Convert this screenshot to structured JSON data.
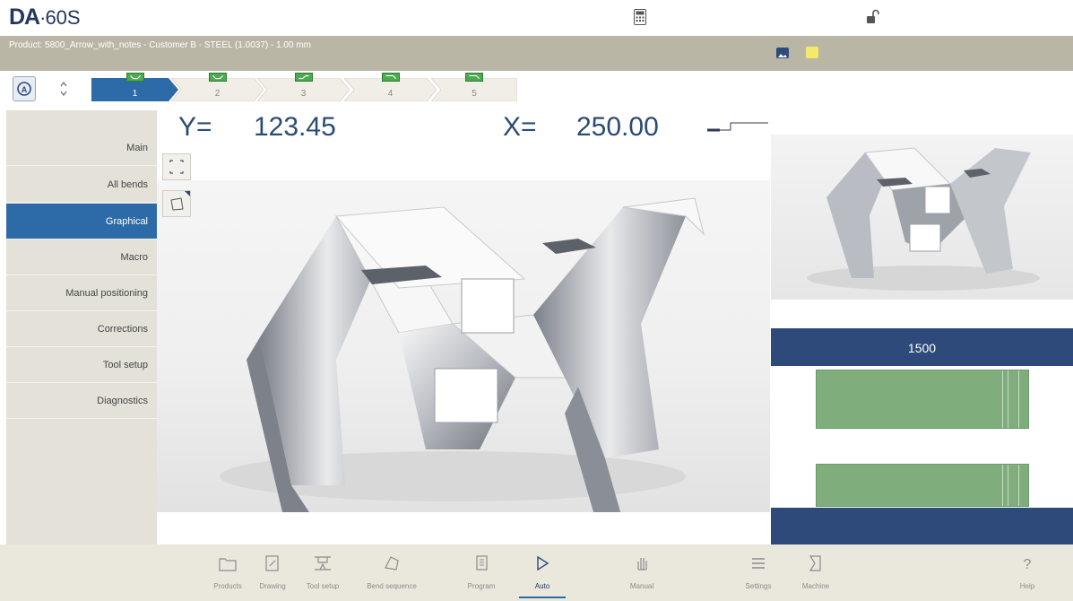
{
  "brand": {
    "logo_main": "DA",
    "logo_dot": "·",
    "logo_model": "60S"
  },
  "topbar": {
    "calculator_icon": "calculator-icon",
    "lock_icon": "unlocked-padlock-icon"
  },
  "product": {
    "text": "Product: 5800_Arrow_with_notes - Customer B - STEEL (1.0037) - 1.00 mm"
  },
  "bends": {
    "active": 0,
    "tabs": [
      {
        "num": "1"
      },
      {
        "num": "2"
      },
      {
        "num": "3"
      },
      {
        "num": "4"
      },
      {
        "num": "5"
      }
    ]
  },
  "menu": {
    "items": [
      {
        "label": "Main"
      },
      {
        "label": "All bends"
      },
      {
        "label": "Graphical",
        "active": true
      },
      {
        "label": "Macro"
      },
      {
        "label": "Manual positioning"
      },
      {
        "label": "Corrections"
      },
      {
        "label": "Tool setup"
      },
      {
        "label": "Diagnostics"
      }
    ]
  },
  "positions": {
    "y_label": "Y=",
    "y_value": "123.45",
    "x_label": "X=",
    "x_value": "250.00"
  },
  "machine_view": {
    "length": "1500"
  },
  "colors": {
    "accent": "#2d6aa8",
    "navy": "#2d4a7a",
    "product_bar": "#bab6a6",
    "menu_bg": "#e3e1d8",
    "tool_green": "#7fae7c",
    "bend_green": "#4daa50"
  },
  "nav": {
    "items": [
      {
        "label": "Products",
        "icon": "folder-icon"
      },
      {
        "label": "Drawing",
        "icon": "pencil-icon"
      },
      {
        "label": "Tool setup",
        "icon": "tool-setup-icon"
      },
      {
        "label": "Bend sequence",
        "icon": "bend-sequence-icon"
      },
      {
        "label": "Program",
        "icon": "program-icon"
      },
      {
        "label": "Auto",
        "icon": "play-icon",
        "active": true
      },
      {
        "label": "Manual",
        "icon": "hand-icon"
      },
      {
        "label": "Settings",
        "icon": "list-icon"
      },
      {
        "label": "Machine",
        "icon": "machine-icon"
      },
      {
        "label": "Help",
        "icon": "help-icon"
      }
    ]
  }
}
